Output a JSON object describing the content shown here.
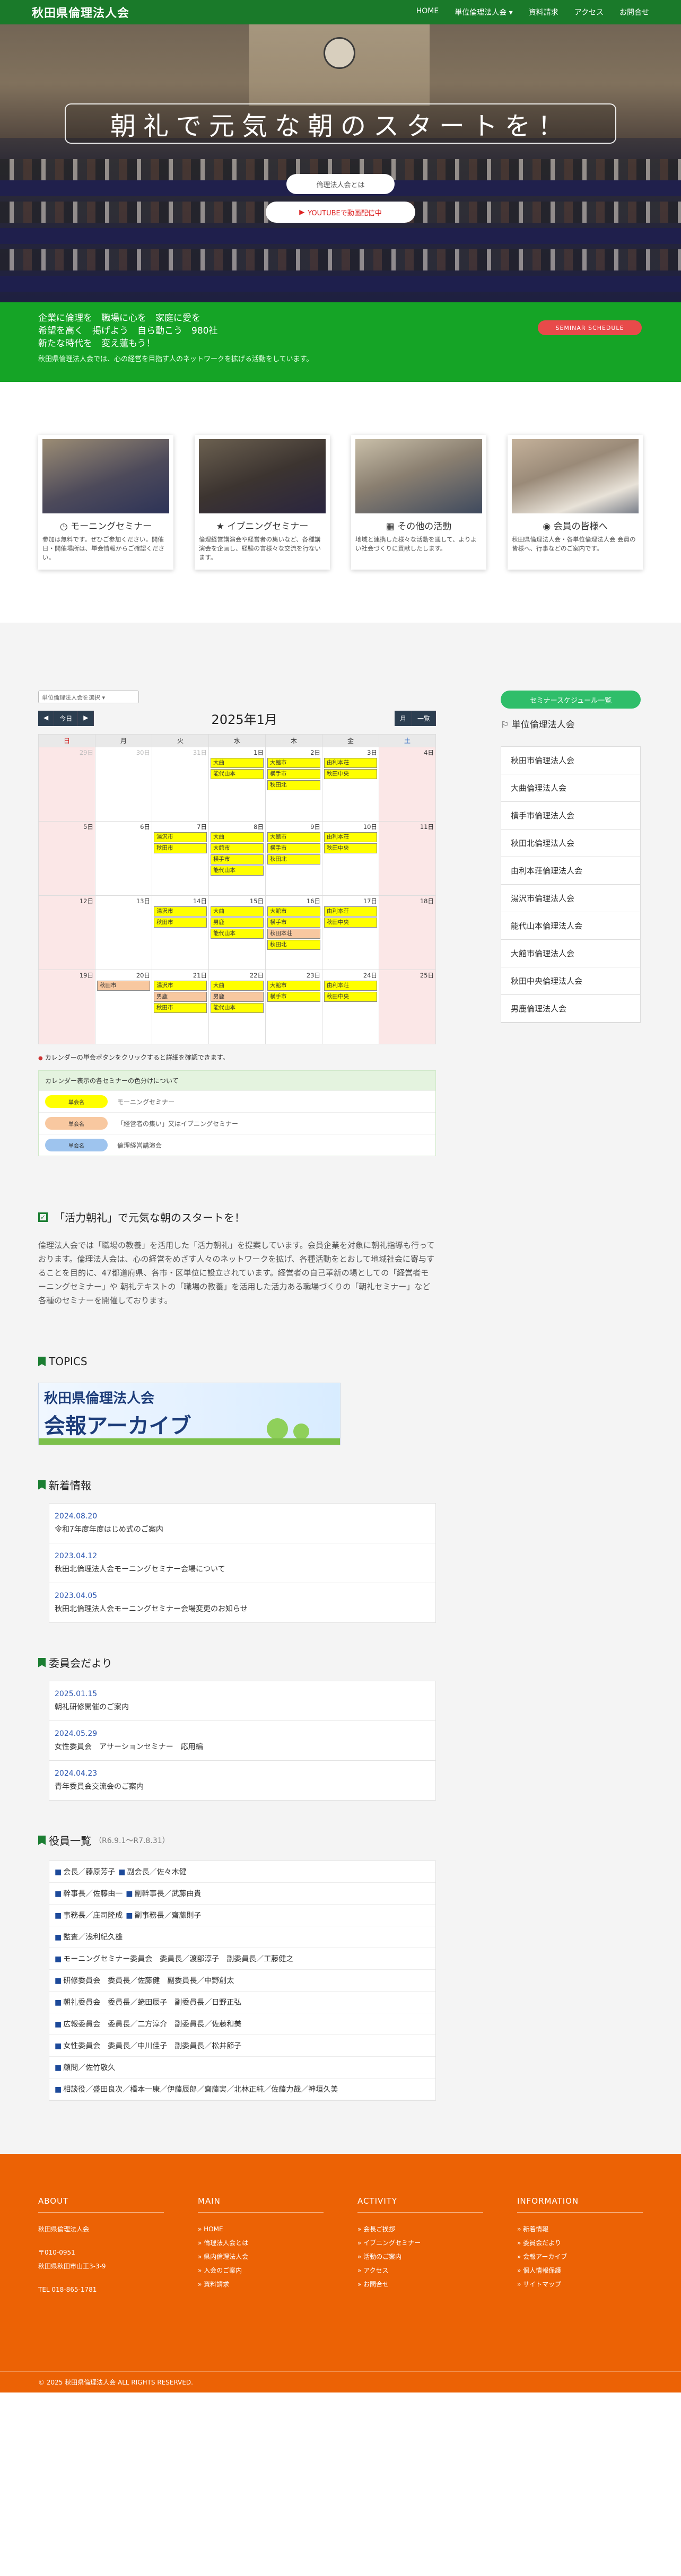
{
  "header": {
    "logo": "秋田県倫理法人会",
    "nav": [
      "HOME",
      "単位倫理法人会 ▾",
      "資料請求",
      "アクセス",
      "お問合せ"
    ]
  },
  "hero": {
    "title": "朝礼で元気な朝のスタートを！",
    "btn_about": "倫理法人会とは",
    "btn_youtube": "YOUTUBEで動画配信中",
    "youtube_icon": "youtube-icon"
  },
  "green": {
    "slogan": [
      "企業に倫理を　職場に心を　家庭に愛を",
      "希望を高く　掲げよう　自ら動こう　980社",
      "新たな時代を　変え蓮もう！"
    ],
    "sub": "秋田県倫理法人会では、心の経営を目指す人のネットワークを拡げる活動をしています。",
    "seminar_btn": "SEMINAR SCHEDULE"
  },
  "features": [
    {
      "title": "モーニングセミナー",
      "icon": "clock-icon",
      "text": "参加は無料です。ぜひご参加ください。開催日・開催場所は、単会情報からご確認ください。"
    },
    {
      "title": "イブニングセミナー",
      "icon": "star-icon",
      "text": "倫理経営講演会や経営者の集いなど、各種講演会を企画し、経験の言様々な交流を行ないます。"
    },
    {
      "title": "その他の活動",
      "icon": "calendar-icon",
      "text": "地域と連携した様々な活動を通して、よりよい社会づくりに貢献したします。"
    },
    {
      "title": "会員の皆様へ",
      "icon": "user-icon",
      "text": "秋田県倫理法人会・各単位倫理法人会 会員の皆様へ、行事などのご案内です。"
    }
  ],
  "calendar": {
    "select_placeholder": "単位倫理法人会を選択",
    "today": "今日",
    "month": "2025年1月",
    "view_month": "月",
    "view_list": "一覧",
    "weekdays": [
      "日",
      "月",
      "火",
      "水",
      "木",
      "金",
      "土"
    ],
    "weeks": [
      [
        {
          "d": "29日",
          "p": true
        },
        {
          "d": "30日",
          "p": true
        },
        {
          "d": "31日",
          "p": true
        },
        {
          "d": "1日",
          "ev": [
            [
              "y",
              "大曲"
            ],
            [
              "y",
              "能代山本"
            ]
          ]
        },
        {
          "d": "2日",
          "ev": [
            [
              "y",
              "大館市"
            ],
            [
              "y",
              "横手市"
            ],
            [
              "y",
              "秋田北"
            ]
          ]
        },
        {
          "d": "3日",
          "ev": [
            [
              "y",
              "由利本荘"
            ],
            [
              "y",
              "秋田中央"
            ]
          ]
        },
        {
          "d": "4日"
        }
      ],
      [
        {
          "d": "5日"
        },
        {
          "d": "6日"
        },
        {
          "d": "7日",
          "ev": [
            [
              "y",
              "湯沢市"
            ],
            [
              "y",
              "秋田市"
            ]
          ]
        },
        {
          "d": "8日",
          "ev": [
            [
              "y",
              "大曲"
            ],
            [
              "y",
              "大館市"
            ],
            [
              "y",
              "横手市"
            ],
            [
              "y",
              "能代山本"
            ]
          ]
        },
        {
          "d": "9日",
          "ev": [
            [
              "y",
              "大館市"
            ],
            [
              "y",
              "横手市"
            ],
            [
              "y",
              "秋田北"
            ]
          ]
        },
        {
          "d": "10日",
          "ev": [
            [
              "y",
              "由利本荘"
            ],
            [
              "y",
              "秋田中央"
            ]
          ]
        },
        {
          "d": "11日"
        }
      ],
      [
        {
          "d": "12日"
        },
        {
          "d": "13日"
        },
        {
          "d": "14日",
          "ev": [
            [
              "y",
              "湯沢市"
            ],
            [
              "y",
              "秋田市"
            ]
          ]
        },
        {
          "d": "15日",
          "ev": [
            [
              "y",
              "大曲"
            ],
            [
              "y",
              "男鹿"
            ],
            [
              "y",
              "能代山本"
            ]
          ]
        },
        {
          "d": "16日",
          "ev": [
            [
              "y",
              "大館市"
            ],
            [
              "y",
              "横手市"
            ],
            [
              "o",
              "秋田本荘"
            ],
            [
              "y",
              "秋田北"
            ]
          ]
        },
        {
          "d": "17日",
          "ev": [
            [
              "y",
              "由利本荘"
            ],
            [
              "y",
              "秋田中央"
            ]
          ]
        },
        {
          "d": "18日"
        }
      ],
      [
        {
          "d": "19日"
        },
        {
          "d": "20日",
          "ev": [
            [
              "o",
              "秋田市"
            ]
          ]
        },
        {
          "d": "21日",
          "ev": [
            [
              "y",
              "湯沢市"
            ],
            [
              "o",
              "男鹿"
            ],
            [
              "y",
              "秋田市"
            ]
          ]
        },
        {
          "d": "22日",
          "ev": [
            [
              "y",
              "大曲"
            ],
            [
              "o",
              "男鹿"
            ],
            [
              "y",
              "能代山本"
            ]
          ]
        },
        {
          "d": "23日",
          "ev": [
            [
              "y",
              "大館市"
            ],
            [
              "y",
              "横手市"
            ]
          ]
        },
        {
          "d": "24日",
          "ev": [
            [
              "y",
              "由利本荘"
            ],
            [
              "y",
              "秋田中央"
            ]
          ]
        },
        {
          "d": "25日"
        }
      ]
    ],
    "note": "カレンダーの単会ボタンをクリックすると詳細を確認できます。",
    "legend_title": "カレンダー表示の各セミナーの色分けについて",
    "legend": [
      {
        "color": "#ffff00",
        "label": "単会名",
        "text": "モーニングセミナー"
      },
      {
        "color": "#f8c8a0",
        "label": "単会名",
        "text": "「経営者の集い」又はイブニングセミナー"
      },
      {
        "color": "#9ec4ee",
        "label": "単会名",
        "text": "倫理経営講演会"
      }
    ]
  },
  "sidebar": {
    "seminar_btn": "セミナースケジュール一覧",
    "title": "単位倫理法人会",
    "items": [
      "秋田市倫理法人会",
      "大曲倫理法人会",
      "横手市倫理法人会",
      "秋田北倫理法人会",
      "由利本荘倫理法人会",
      "湯沢市倫理法人会",
      "能代山本倫理法人会",
      "大館市倫理法人会",
      "秋田中央倫理法人会",
      "男鹿倫理法人会"
    ]
  },
  "katsuryoku": {
    "title": "「活力朝礼」で元気な朝のスタートを！",
    "text": "倫理法人会では「職場の教養」を活用した「活力朝礼」を提案しています。会員企業を対象に朝礼指導も行っております。倫理法人会は、心の経営をめざす人々のネットワークを拡げ、各種活動をとおして地域社会に寄与することを目的に、47都道府県、各市・区単位に設立されています。経営者の自己革新の場としての「経営者モーニングセミナー」や 朝礼テキストの「職場の教養」を活用した活力ある職場づくりの「朝礼セミナー」など各種のセミナーを開催しております。"
  },
  "topics": {
    "title": "TOPICS",
    "banner_line1": "秋田県倫理法人会",
    "banner_line2": "会報アーカイブ"
  },
  "news": {
    "title": "新着情報",
    "items": [
      {
        "date": "2024.08.20",
        "text": "令和7年度年度はじめ式のご案内"
      },
      {
        "date": "2023.04.12",
        "text": "秋田北倫理法人会モーニングセミナー会場について"
      },
      {
        "date": "2023.04.05",
        "text": "秋田北倫理法人会モーニングセミナー会場変更のお知らせ"
      }
    ]
  },
  "committee": {
    "title": "委員会だより",
    "items": [
      {
        "date": "2025.01.15",
        "text": "朝礼研修開催のご案内"
      },
      {
        "date": "2024.05.29",
        "text": "女性委員会　アサーションセミナー　応用編"
      },
      {
        "date": "2024.04.23",
        "text": "青年委員会交流会のご案内"
      }
    ]
  },
  "officers": {
    "title": "役員一覧",
    "period": "（R6.9.1〜R7.8.31）",
    "rows": [
      [
        "会長／藤原芳子",
        "副会長／佐々木健"
      ],
      [
        "幹事長／佐藤由一",
        "副幹事長／武藤由貴"
      ],
      [
        "事務長／庄司隆成",
        "副事務長／齋藤則子"
      ],
      [
        "監査／浅利紀久雄"
      ],
      [
        "モーニングセミナー委員会　委員長／渡部淳子　副委員長／工藤健之"
      ],
      [
        "研修委員会　委員長／佐藤健　副委員長／中野創太"
      ],
      [
        "朝礼委員会　委員長／蛯田辰子　副委員長／日野正弘"
      ],
      [
        "広報委員会　委員長／二方淳介　副委員長／佐藤和美"
      ],
      [
        "女性委員会　委員長／中川佳子　副委員長／松井節子"
      ],
      [
        "顧問／佐竹敬久"
      ],
      [
        "相談役／盛田良次／橋本一康／伊藤辰郎／齋藤実／北林正純／佐藤力哉／神垣久美"
      ]
    ]
  },
  "footer": {
    "about_title": "ABOUT",
    "about": [
      "秋田県倫理法人会",
      "",
      "〒010-0951",
      "秋田県秋田市山王3-3-9",
      "",
      "TEL 018-865-1781"
    ],
    "main_title": "MAIN",
    "main": [
      "HOME",
      "倫理法人会とは",
      "県内倫理法人会",
      "入会のご案内",
      "資料請求"
    ],
    "activity_title": "ACTIVITY",
    "activity": [
      "会長ご挨拶",
      "イブニングセミナー",
      "活動のご案内",
      "アクセス",
      "お問合せ"
    ],
    "info_title": "INFORMATION",
    "info": [
      "新着情報",
      "委員会だより",
      "会報アーカイブ",
      "個人情報保護",
      "サイトマップ"
    ],
    "copyright": "© 2025 秋田県倫理法人会 ALL RIGHTS RESERVED."
  }
}
